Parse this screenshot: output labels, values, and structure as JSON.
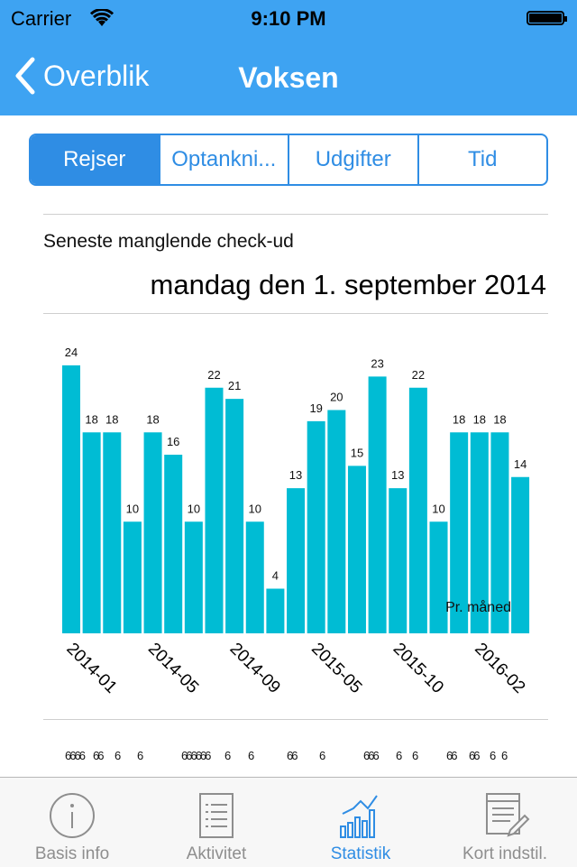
{
  "status_bar": {
    "carrier": "Carrier",
    "time": "9:10 PM"
  },
  "nav": {
    "back_label": "Overblik",
    "title": "Voksen"
  },
  "segments": [
    {
      "label": "Rejser",
      "active": true
    },
    {
      "label": "Optankni...",
      "active": false
    },
    {
      "label": "Udgifter",
      "active": false
    },
    {
      "label": "Tid",
      "active": false
    }
  ],
  "info": {
    "label": "Seneste manglende check-ud",
    "date": "mandag den 1. september 2014"
  },
  "chart_data": {
    "type": "bar",
    "values": [
      24,
      18,
      18,
      10,
      18,
      16,
      10,
      22,
      21,
      10,
      4,
      13,
      19,
      20,
      15,
      23,
      13,
      22,
      10,
      18,
      18,
      18,
      14
    ],
    "tick_labels": [
      {
        "index": 0,
        "label": "2014-01"
      },
      {
        "index": 4,
        "label": "2014-05"
      },
      {
        "index": 8,
        "label": "2014-09"
      },
      {
        "index": 12,
        "label": "2015-05"
      },
      {
        "index": 16,
        "label": "2015-10"
      },
      {
        "index": 20,
        "label": "2016-02"
      }
    ],
    "legend": "Pr. måned",
    "ylim": [
      0,
      24
    ],
    "bar_color": "#00bcd4",
    "grid": false
  },
  "footer_sixes": [
    "6666",
    "66",
    "6",
    "6",
    "666666",
    "6",
    "6",
    "66",
    "6",
    "666",
    "6",
    "6",
    "66",
    "66",
    "6",
    "6"
  ],
  "tabs": [
    {
      "label": "Basis info",
      "icon": "info-icon"
    },
    {
      "label": "Aktivitet",
      "icon": "list-icon"
    },
    {
      "label": "Statistik",
      "icon": "chart-icon",
      "active": true
    },
    {
      "label": "Kort indstil.",
      "icon": "card-edit-icon"
    }
  ],
  "colors": {
    "accent": "#3ea3f2",
    "segment": "#2f8de4"
  }
}
